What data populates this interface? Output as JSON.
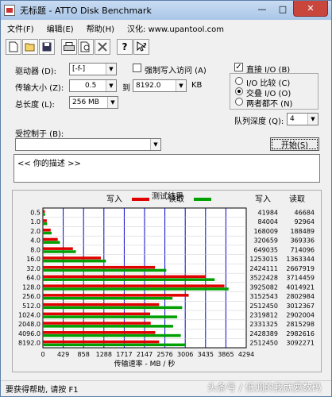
{
  "window": {
    "title": "无标题 - ATTO Disk Benchmark",
    "min": "—",
    "max": "□",
    "close": "✕"
  },
  "menu": [
    "文件(F)",
    "编辑(E)",
    "帮助(H)",
    "汉化: www.upantool.com"
  ],
  "toolbar": {
    "icons": [
      "new-icon",
      "open-icon",
      "save-icon",
      "print-icon",
      "print-preview-icon",
      "options-icon",
      "help-icon",
      "context-help-icon"
    ]
  },
  "form": {
    "drive_label": "驱动器 (D):",
    "drive_value": "[-f-]",
    "transfer_label": "传输大小 (Z):",
    "transfer_from": "0.5",
    "to_label": "到",
    "transfer_to": "8192.0",
    "kb_unit": "KB",
    "length_label": "总长度 (L):",
    "length_value": "256 MB",
    "force_write_label": "强制写入访问 (A)",
    "force_write_checked": false,
    "direct_io_label": "直接 I/O (B)",
    "direct_io_checked": true,
    "io_compare_label": "I/O 比较 (C)",
    "overlap_io_label": "交叠 I/O (O)",
    "neither_label": "两者都不 (N)",
    "selected_mode": "overlap",
    "queue_label": "队列深度 (Q):",
    "queue_value": "4",
    "controlled_label": "受控制于 (B):",
    "controlled_value": "",
    "start_label": "开始(S)",
    "description": "<<  你的描述  >>"
  },
  "results": {
    "title": "测试结果",
    "write_legend": "写入",
    "read_legend": "读取",
    "write_col": "写入",
    "read_col": "读取"
  },
  "colors": {
    "write": "#e00000",
    "read": "#00a000",
    "grid": "#0000cc"
  },
  "chart_data": {
    "type": "bar",
    "orientation": "horizontal",
    "title": "测试结果",
    "xlabel": "传输速率 - MB / 秒",
    "categories": [
      "0.5",
      "1.0",
      "2.0",
      "4.0",
      "8.0",
      "16.0",
      "32.0",
      "64.0",
      "128.0",
      "256.0",
      "512.0",
      "1024.0",
      "2048.0",
      "4096.0",
      "8192.0"
    ],
    "xticks": [
      "0",
      "429",
      "858",
      "1288",
      "1717",
      "2147",
      "2576",
      "3006",
      "3435",
      "3865",
      "4294"
    ],
    "xlim": [
      0,
      4294
    ],
    "series": [
      {
        "name": "写入",
        "values": [
          41984,
          84004,
          168009,
          320659,
          649035,
          1253015,
          2424111,
          3522428,
          3925082,
          3152543,
          2512450,
          2319812,
          2331325,
          2428389,
          2512450
        ]
      },
      {
        "name": "读取",
        "values": [
          46684,
          92964,
          188489,
          369336,
          714096,
          1363344,
          2667919,
          3714459,
          4014921,
          2802984,
          3012367,
          2902004,
          2815298,
          2982616,
          3092271
        ]
      }
    ],
    "grid": true
  },
  "status": {
    "text": "要获得帮助, 请按 F1"
  },
  "watermark": "头条号 / 低调的我就要数码"
}
